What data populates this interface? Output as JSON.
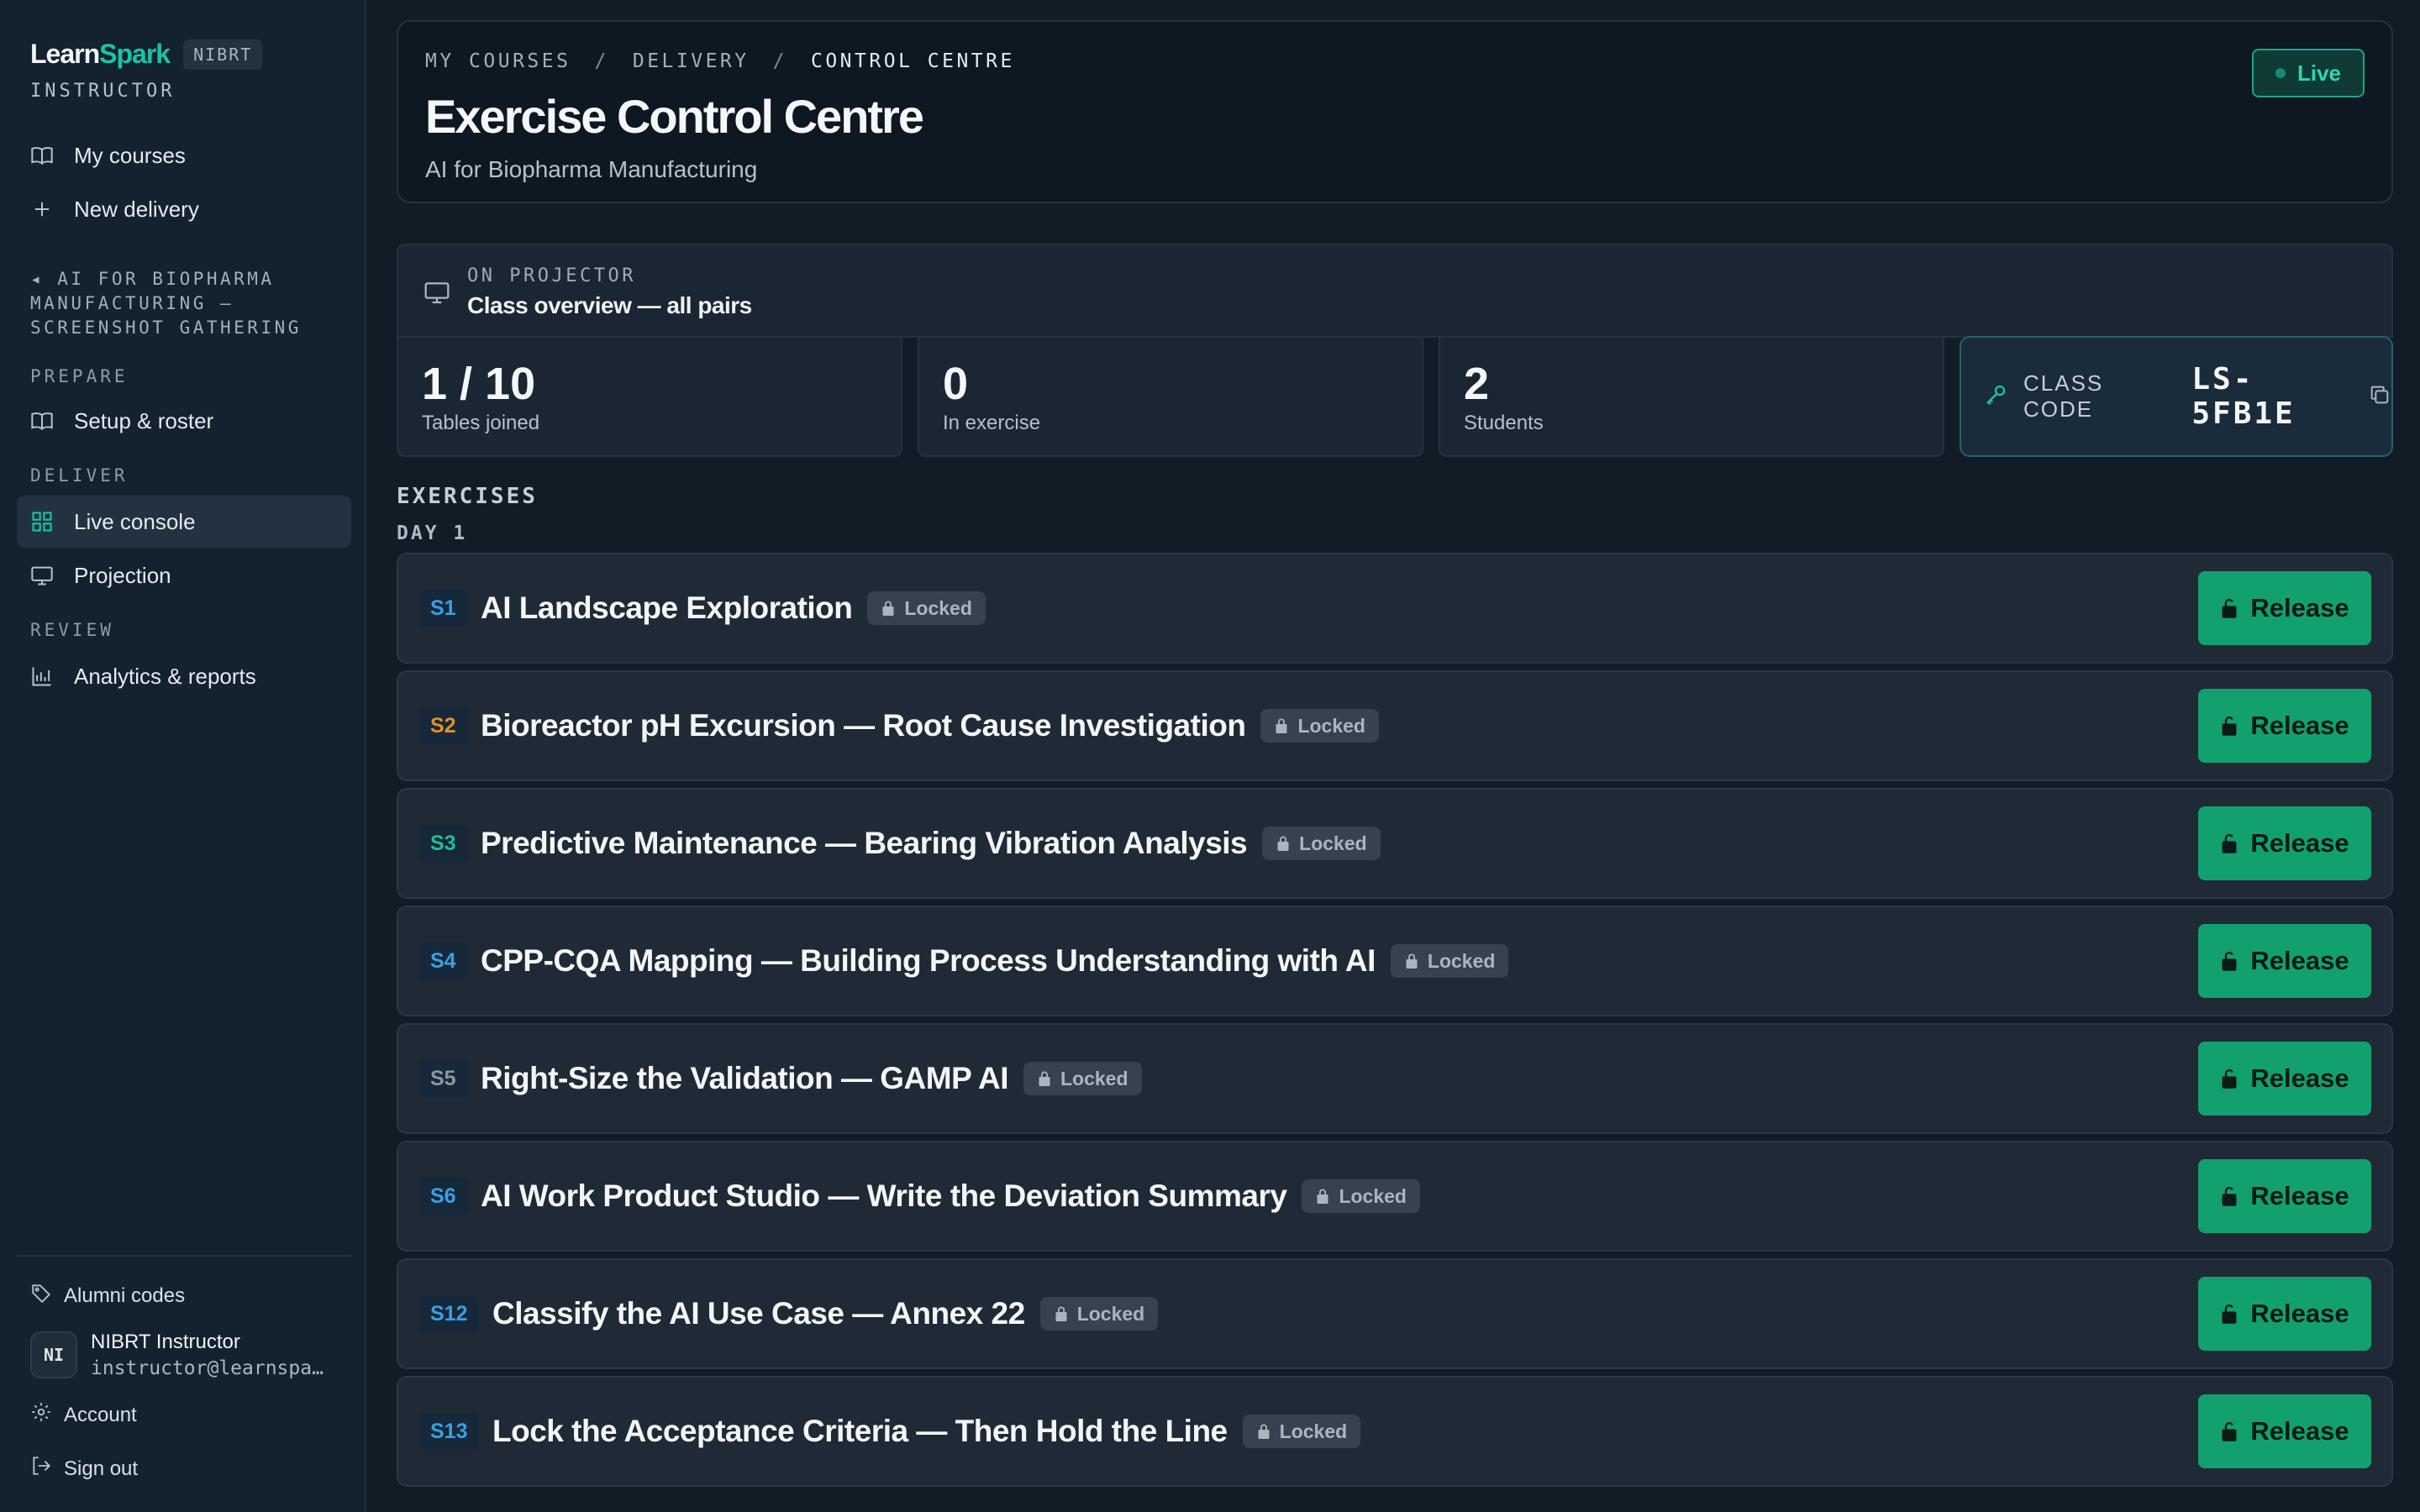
{
  "brand": {
    "name_a": "Learn",
    "name_b": "Spark",
    "org": "NIBRT",
    "role": "INSTRUCTOR"
  },
  "nav": {
    "my_courses": "My courses",
    "new_delivery": "New delivery",
    "course_crumb": "◂ AI FOR BIOPHARMA MANUFACTURING — SCREENSHOT GATHERING",
    "prepare_label": "PREPARE",
    "setup_roster": "Setup & roster",
    "deliver_label": "DELIVER",
    "live_console": "Live console",
    "projection": "Projection",
    "review_label": "REVIEW",
    "analytics": "Analytics & reports"
  },
  "footer": {
    "alumni_codes": "Alumni codes",
    "user_initials": "NI",
    "user_name": "NIBRT Instructor",
    "user_email": "instructor@learnspark.ai",
    "account": "Account",
    "sign_out": "Sign out"
  },
  "header": {
    "breadcrumb": [
      "MY COURSES",
      "DELIVERY",
      "CONTROL CENTRE"
    ],
    "separator": "/",
    "title": "Exercise Control Centre",
    "subtitle": "AI for Biopharma Manufacturing",
    "status": "Live"
  },
  "projector": {
    "label": "ON PROJECTOR",
    "value": "Class overview — all pairs"
  },
  "stats": [
    {
      "value": "1 / 10",
      "label": "Tables joined"
    },
    {
      "value": "0",
      "label": "In exercise"
    },
    {
      "value": "2",
      "label": "Students"
    }
  ],
  "class_code": {
    "label": "CLASS CODE",
    "value": "LS-5FB1E"
  },
  "exercises": {
    "heading": "EXERCISES",
    "day_label": "DAY 1",
    "locked_label": "Locked",
    "release_label": "Release",
    "items": [
      {
        "code": "S1",
        "title": "AI Landscape Exploration",
        "color": "#3aa0e0"
      },
      {
        "code": "S2",
        "title": "Bioreactor pH Excursion — Root Cause Investigation",
        "color": "#e0902a"
      },
      {
        "code": "S3",
        "title": "Predictive Maintenance — Bearing Vibration Analysis",
        "color": "#1fbf8f"
      },
      {
        "code": "S4",
        "title": "CPP-CQA Mapping — Building Process Understanding with AI",
        "color": "#3aa0e0"
      },
      {
        "code": "S5",
        "title": "Right-Size the Validation — GAMP AI",
        "color": "#8a97a5"
      },
      {
        "code": "S6",
        "title": "AI Work Product Studio — Write the Deviation Summary",
        "color": "#3aa0e0"
      },
      {
        "code": "S12",
        "title": "Classify the AI Use Case — Annex 22",
        "color": "#3aa0e0"
      },
      {
        "code": "S13",
        "title": "Lock the Acceptance Criteria — Then Hold the Line",
        "color": "#3aa0e0"
      }
    ]
  },
  "colors": {
    "accent": "#19c3a4",
    "release": "#13a06f",
    "live": "#2fd6b3"
  }
}
